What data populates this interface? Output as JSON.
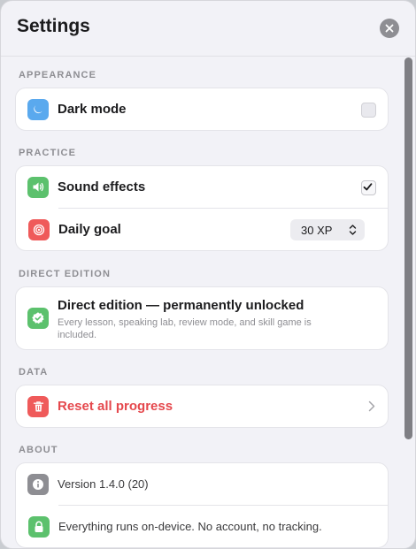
{
  "header": {
    "title": "Settings"
  },
  "sections": {
    "appearance": {
      "label": "APPEARANCE",
      "dark_mode": "Dark mode",
      "dark_mode_checked": false
    },
    "practice": {
      "label": "PRACTICE",
      "sound_effects": "Sound effects",
      "sound_effects_checked": true,
      "daily_goal": "Daily goal",
      "daily_goal_value": "30 XP"
    },
    "edition": {
      "label": "DIRECT EDITION",
      "title": "Direct edition — permanently unlocked",
      "subtitle": "Every lesson, speaking lab, review mode, and skill game is included."
    },
    "data": {
      "label": "DATA",
      "reset": "Reset all progress"
    },
    "about": {
      "label": "ABOUT",
      "version": "Version 1.4.0 (20)",
      "privacy": "Everything runs on-device. No account, no tracking."
    }
  },
  "colors": {
    "dark_mode_icon": "#5aa9ee",
    "sound_icon": "#5cc16d",
    "goal_icon": "#ef5a5a",
    "edition_icon": "#5cc16d",
    "reset_icon": "#ef5a5a",
    "info_icon": "#8e8e93",
    "lock_icon": "#5cc16d",
    "danger_text": "#e5484d"
  },
  "icons": {
    "close": "close-icon",
    "dark_mode": "moon-icon",
    "sound": "speaker-icon",
    "goal": "target-icon",
    "edition": "verified-check-icon",
    "reset": "trash-icon",
    "version": "info-icon",
    "privacy": "lock-icon"
  }
}
